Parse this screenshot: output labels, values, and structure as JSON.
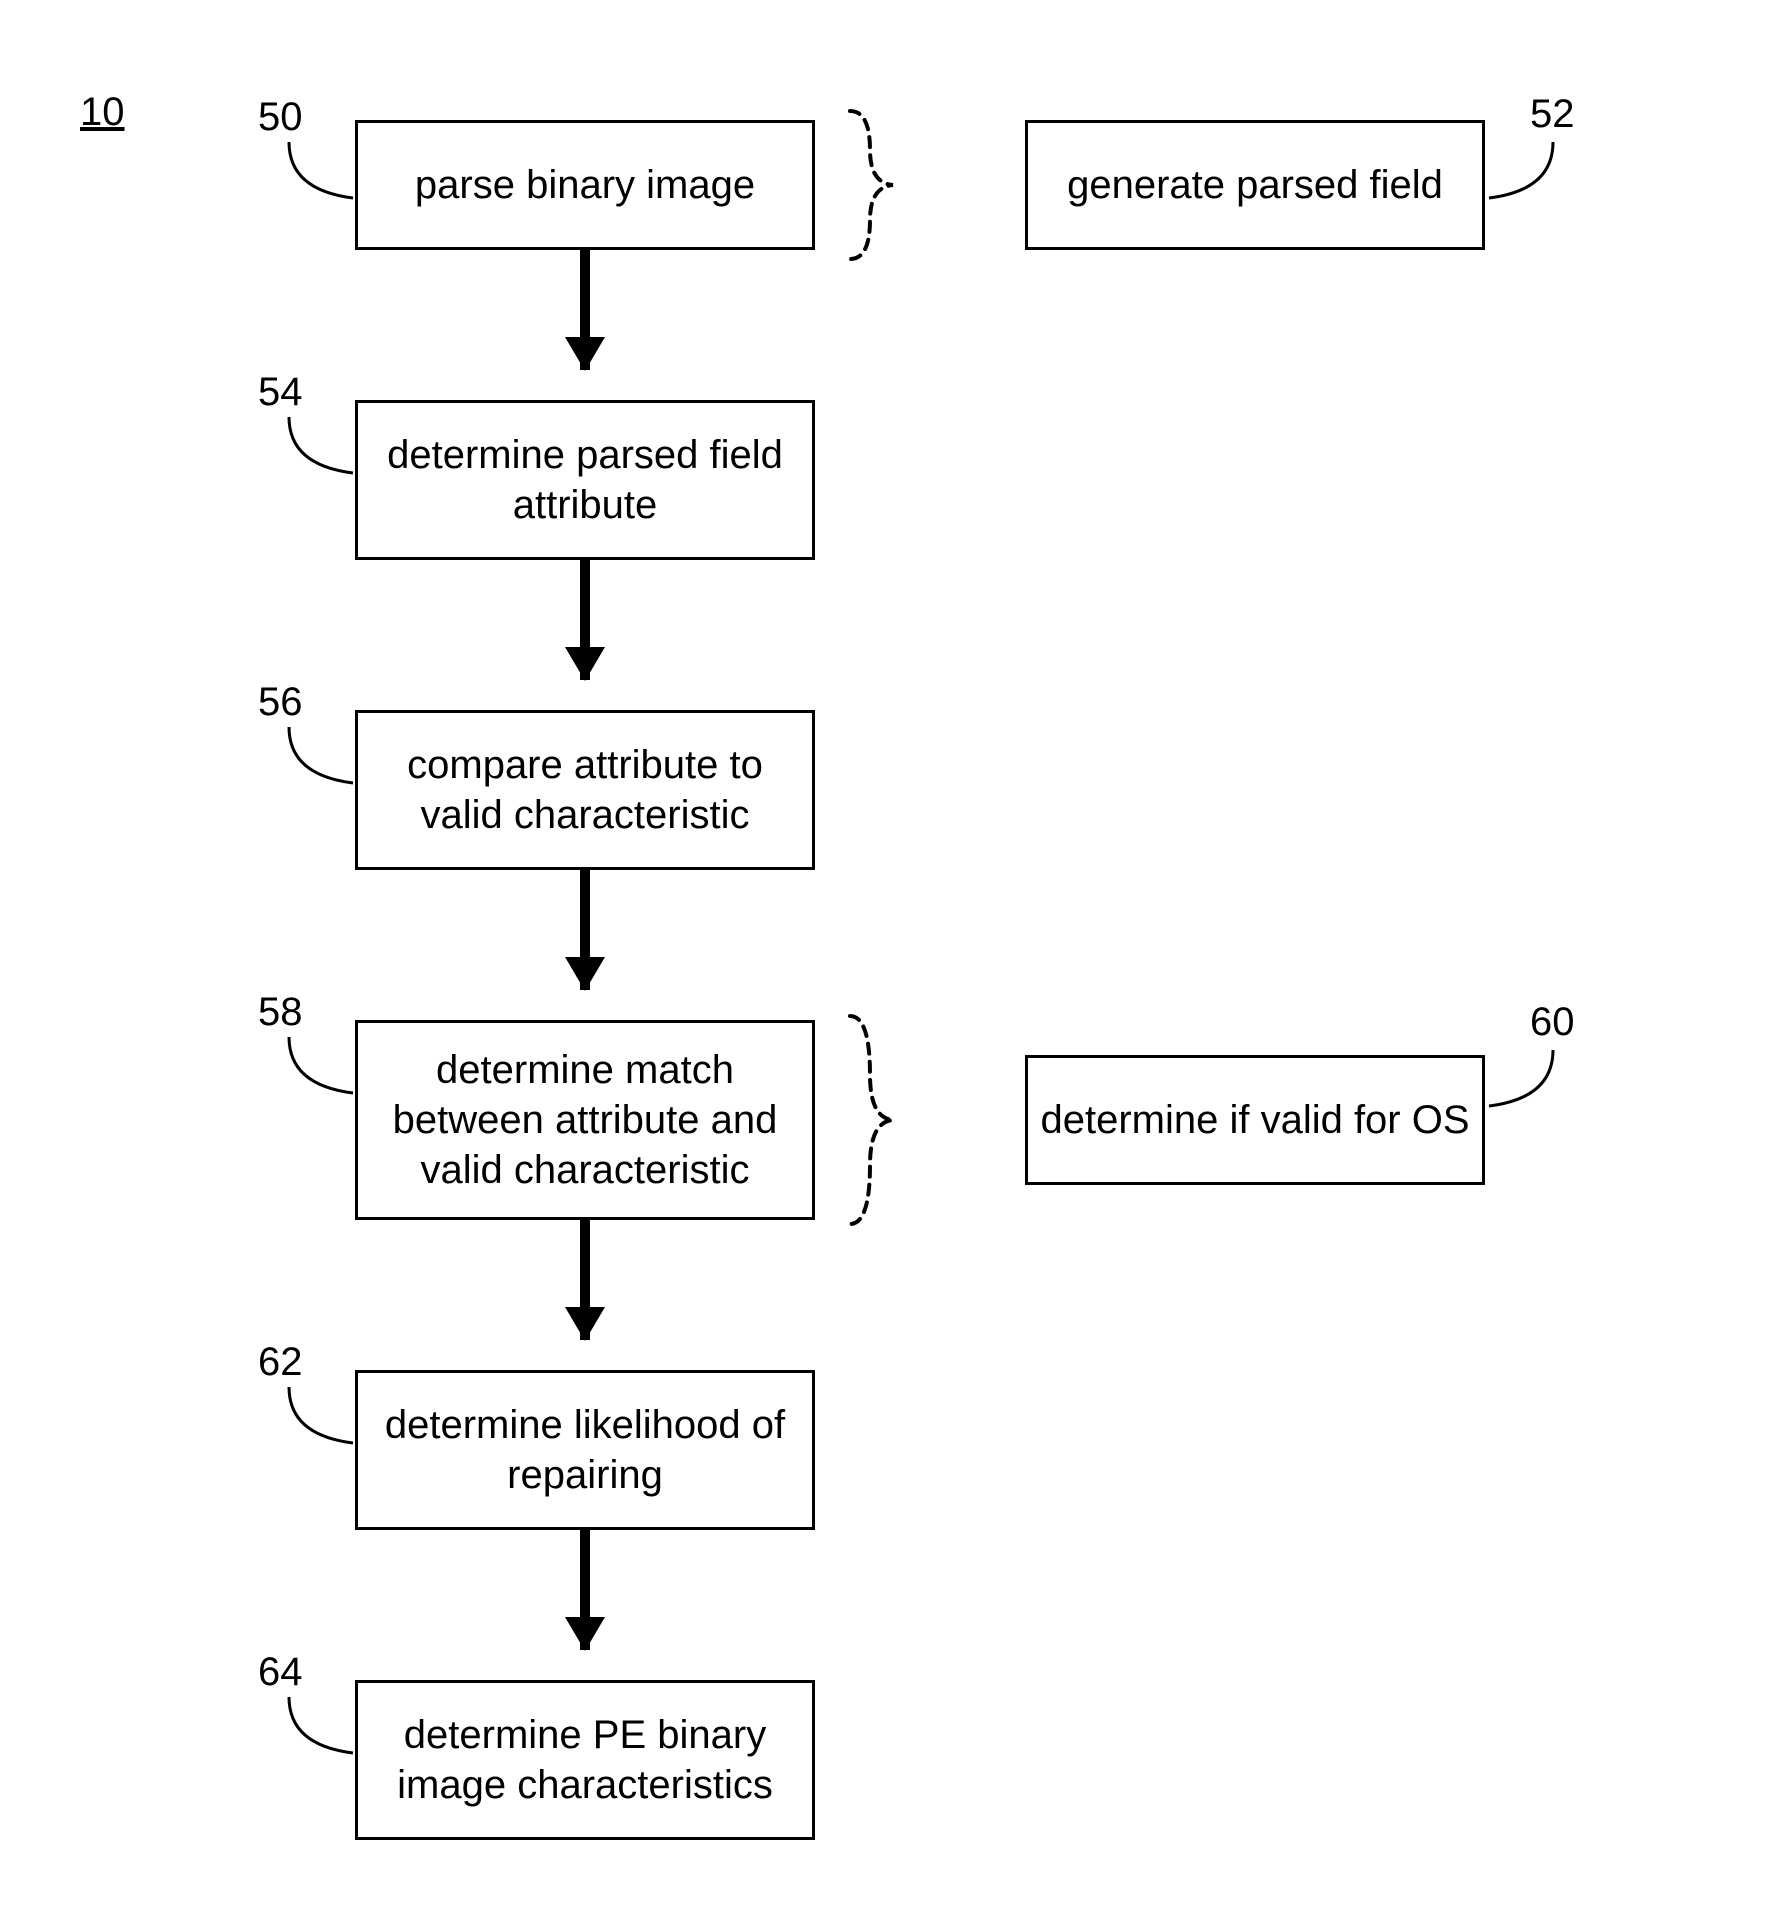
{
  "diagram": {
    "id": "10",
    "steps": {
      "s50": {
        "num": "50",
        "text": "parse binary image"
      },
      "s52": {
        "num": "52",
        "text": "generate parsed field"
      },
      "s54": {
        "num": "54",
        "text": "determine parsed field attribute"
      },
      "s56": {
        "num": "56",
        "text": "compare attribute to valid characteristic"
      },
      "s58": {
        "num": "58",
        "text": "determine match between attribute and valid characteristic"
      },
      "s60": {
        "num": "60",
        "text": "determine if valid for OS"
      },
      "s62": {
        "num": "62",
        "text": "determine likelihood of repairing"
      },
      "s64": {
        "num": "64",
        "text": "determine PE binary image characteristics"
      }
    }
  }
}
